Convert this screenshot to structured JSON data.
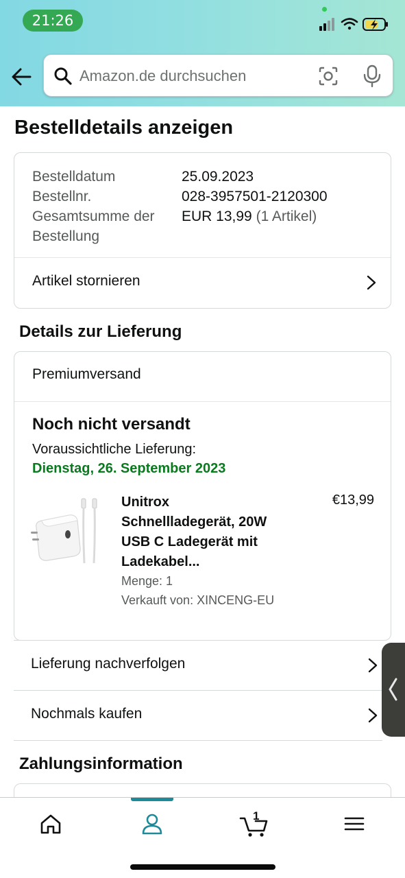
{
  "status_bar": {
    "time": "21:26"
  },
  "search": {
    "placeholder": "Amazon.de durchsuchen"
  },
  "page_title": "Bestelldetails anzeigen",
  "order_summary": {
    "date_label": "Bestelldatum",
    "date_value": "25.09.2023",
    "number_label": "Bestellnr.",
    "number_value": "028-3957501-2120300",
    "total_label_line1": "Gesamtsumme der",
    "total_label_line2": "Bestellung",
    "total_value": "EUR 13,99",
    "total_items": "(1 Artikel)",
    "cancel_label": "Artikel stornieren"
  },
  "delivery": {
    "section_title": "Details zur Lieferung",
    "shipping_method": "Premiumversand",
    "status": "Noch nicht versandt",
    "estimate_label": "Voraussichtliche Lieferung:",
    "estimate_date": "Dienstag, 26. September 2023",
    "product": {
      "title_lines": [
        "Unitrox",
        "Schnellladegerät, 20W",
        "USB C Ladegerät mit",
        "Ladekabel..."
      ],
      "price": "€13,99",
      "quantity": "Menge: 1",
      "seller": "Verkauft von: XINCENG-EU"
    }
  },
  "actions": {
    "track": "Lieferung nachverfolgen",
    "buy_again": "Nochmals kaufen"
  },
  "payment": {
    "section_title": "Zahlungsinformation"
  },
  "bottom_nav": {
    "cart_count": "1",
    "icons": [
      "home-icon",
      "account-icon",
      "cart-icon",
      "menu-icon"
    ],
    "active_index": 1
  },
  "colors": {
    "header_gradient_start": "#82d8e3",
    "header_gradient_end": "#a5e6d4",
    "delivery_green": "#0a7a1f",
    "nav_accent": "#1c8a99",
    "time_pill": "#35a853"
  }
}
